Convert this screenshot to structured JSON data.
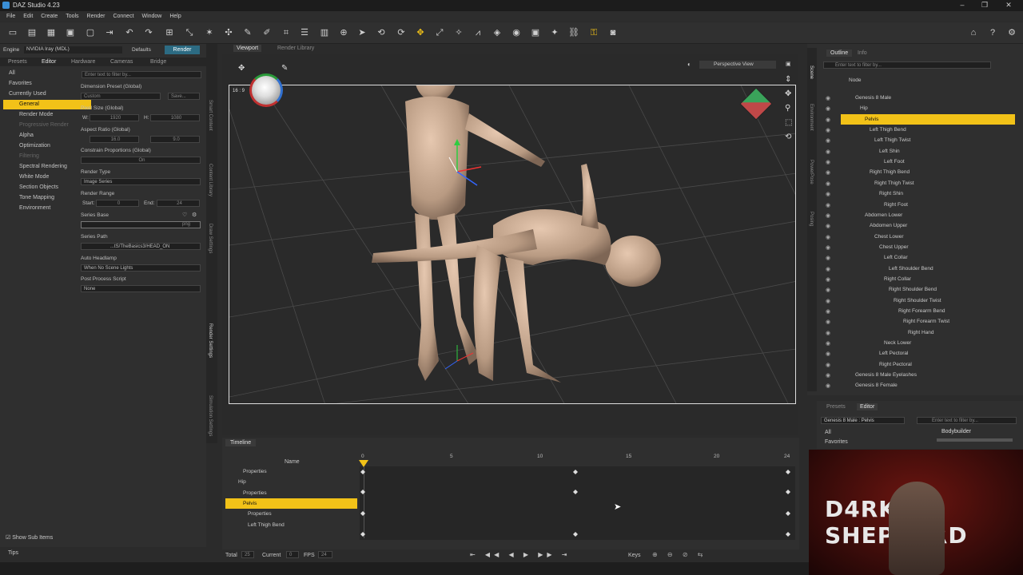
{
  "window": {
    "title": "DAZ Studio 4.23"
  },
  "menu": [
    "File",
    "Edit",
    "Create",
    "Tools",
    "Render",
    "Connect",
    "Window",
    "Help"
  ],
  "left_panel": {
    "engine_label": "Engine",
    "engine_value": "NVIDIA Iray (MDL)",
    "defaults_tab": "Defaults",
    "render_button": "Render",
    "tabs": [
      "Presets",
      "Editor",
      "Hardware",
      "Cameras",
      "Bridge"
    ],
    "filter_placeholder": "Enter text to filter by...",
    "categories": [
      "All",
      "Favorites",
      "Currently Used",
      "General",
      "Render Mode",
      "Progressive Render",
      "Alpha",
      "Optimization",
      "Filtering",
      "Spectral Rendering",
      "White Mode",
      "Section Objects",
      "Tone Mapping",
      "Environment"
    ],
    "selected_category": "General",
    "properties": {
      "dimension_preset_label": "Dimension Preset (Global)",
      "dimension_preset_value": "Custom",
      "save_button": "Save...",
      "pixel_size_label": "Pixel Size (Global)",
      "w_label": "W:",
      "w_value": "1920",
      "h_label": "H:",
      "h_value": "1080",
      "aspect_label": "Aspect Ratio (Global)",
      "aspect_w": "16.0",
      "aspect_h": "9.0",
      "constrain_label": "Constrain Proportions (Global)",
      "constrain_value": "On",
      "render_type_label": "Render Type",
      "render_type_value": "Image Series",
      "render_range_label": "Render Range",
      "start_label": "Start:",
      "start_value": "0",
      "end_label": "End:",
      "end_value": "24",
      "series_base_label": "Series Base",
      "series_base_ext": "png",
      "series_path_label": "Series Path",
      "series_path_value": "...tS/TheBasics3/HEAD_ON",
      "auto_headlamp_label": "Auto Headlamp",
      "auto_headlamp_value": "When No Scene Lights",
      "post_process_label": "Post Process Script",
      "post_process_value": "None"
    },
    "show_sub_items": "Show Sub Items",
    "tips": "Tips"
  },
  "side_tabs_left": [
    "Render Settings",
    "Simulation Settings",
    "Smart Content",
    "Content Library",
    "Draw Settings"
  ],
  "viewport": {
    "tabs": [
      "Viewport",
      "Render Library"
    ],
    "view_mode": "Perspective View",
    "aspect_badge": "16 : 9"
  },
  "scene": {
    "tabs": [
      "Outline",
      "Info"
    ],
    "filter_placeholder": "Enter text to filter by...",
    "header": "Node",
    "nodes": [
      {
        "label": "Genesis 8 Male",
        "indent": 0
      },
      {
        "label": "Hip",
        "indent": 1
      },
      {
        "label": "Pelvis",
        "indent": 2,
        "selected": true
      },
      {
        "label": "Left Thigh Bend",
        "indent": 3
      },
      {
        "label": "Left Thigh Twist",
        "indent": 4
      },
      {
        "label": "Left Shin",
        "indent": 5
      },
      {
        "label": "Left Foot",
        "indent": 6
      },
      {
        "label": "Right Thigh Bend",
        "indent": 3
      },
      {
        "label": "Right Thigh Twist",
        "indent": 4
      },
      {
        "label": "Right Shin",
        "indent": 5
      },
      {
        "label": "Right Foot",
        "indent": 6
      },
      {
        "label": "Abdomen Lower",
        "indent": 2
      },
      {
        "label": "Abdomen Upper",
        "indent": 3
      },
      {
        "label": "Chest Lower",
        "indent": 4
      },
      {
        "label": "Chest Upper",
        "indent": 5
      },
      {
        "label": "Left Collar",
        "indent": 6
      },
      {
        "label": "Left Shoulder Bend",
        "indent": 7
      },
      {
        "label": "Right Collar",
        "indent": 6
      },
      {
        "label": "Right Shoulder Bend",
        "indent": 7
      },
      {
        "label": "Right Shoulder Twist",
        "indent": 8
      },
      {
        "label": "Right Forearm Bend",
        "indent": 9
      },
      {
        "label": "Right Forearm Twist",
        "indent": 10
      },
      {
        "label": "Right Hand",
        "indent": 11
      },
      {
        "label": "Neck Lower",
        "indent": 6
      },
      {
        "label": "Left Pectoral",
        "indent": 5
      },
      {
        "label": "Right Pectoral",
        "indent": 5
      },
      {
        "label": "Genesis 8 Male Eyelashes",
        "indent": 0
      },
      {
        "label": "Genesis 8 Female",
        "indent": 0
      }
    ],
    "side_tabs": [
      "Scene",
      "Environment",
      "PowerPose",
      "Posing"
    ]
  },
  "presets_panel": {
    "tabs": [
      "Presets",
      "Editor"
    ],
    "dropdown": "Genesis 8 Male : Pelvis",
    "filter_placeholder": "Enter text to filter by...",
    "items": [
      "All",
      "Favorites"
    ],
    "property": "Bodybuilder"
  },
  "timeline": {
    "title": "Timeline",
    "name_header": "Name",
    "rows": [
      {
        "label": "Properties",
        "indent": 1
      },
      {
        "label": "Hip",
        "indent": 0
      },
      {
        "label": "Properties",
        "indent": 1
      },
      {
        "label": "Pelvis",
        "indent": 1,
        "selected": true
      },
      {
        "label": "Properties",
        "indent": 2
      },
      {
        "label": "Left Thigh Bend",
        "indent": 2
      }
    ],
    "ticks": [
      "0",
      "5",
      "10",
      "15",
      "20",
      "24"
    ],
    "total_label": "Total",
    "total_value": "25",
    "current_label": "Current",
    "current_value": "0",
    "fps_label": "FPS",
    "fps_value": "24",
    "keys_label": "Keys"
  },
  "webcam": {
    "logo_text": "D4RK SHEPHERD"
  }
}
